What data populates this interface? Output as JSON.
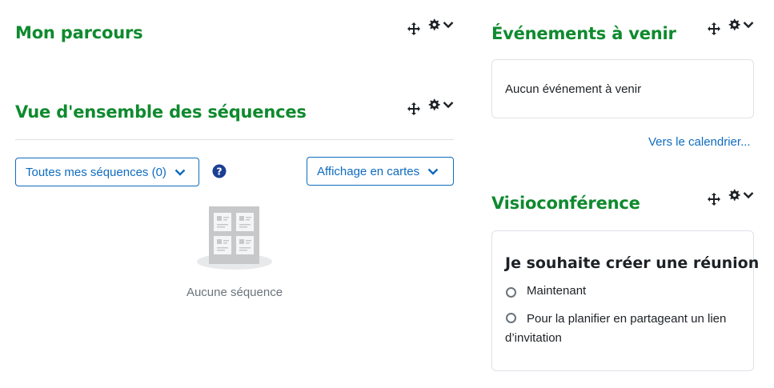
{
  "blocks": {
    "mon_parcours": {
      "title": "Mon parcours"
    },
    "overview": {
      "title": "Vue d'ensemble des séquences",
      "filter_label": "Toutes mes séquences (0)",
      "view_label": "Affichage en cartes",
      "empty_text": "Aucune séquence"
    },
    "events": {
      "title": "Événements à venir",
      "empty_text": "Aucun événement à venir",
      "calendar_link": "Vers le calendrier..."
    },
    "visio": {
      "title": "Visioconférence",
      "heading": "Je souhaite créer une réunion",
      "options": [
        "Maintenant",
        "Pour la planifier en partageant un lien d’invitation"
      ]
    }
  },
  "icons": {
    "move": "move-icon",
    "gear": "gear-icon",
    "chevron": "chevron-down-icon",
    "help": "help-icon"
  },
  "colors": {
    "title_green": "#0f8a2e",
    "link_blue": "#0f6cbf",
    "help_navy": "#1c3f94"
  }
}
